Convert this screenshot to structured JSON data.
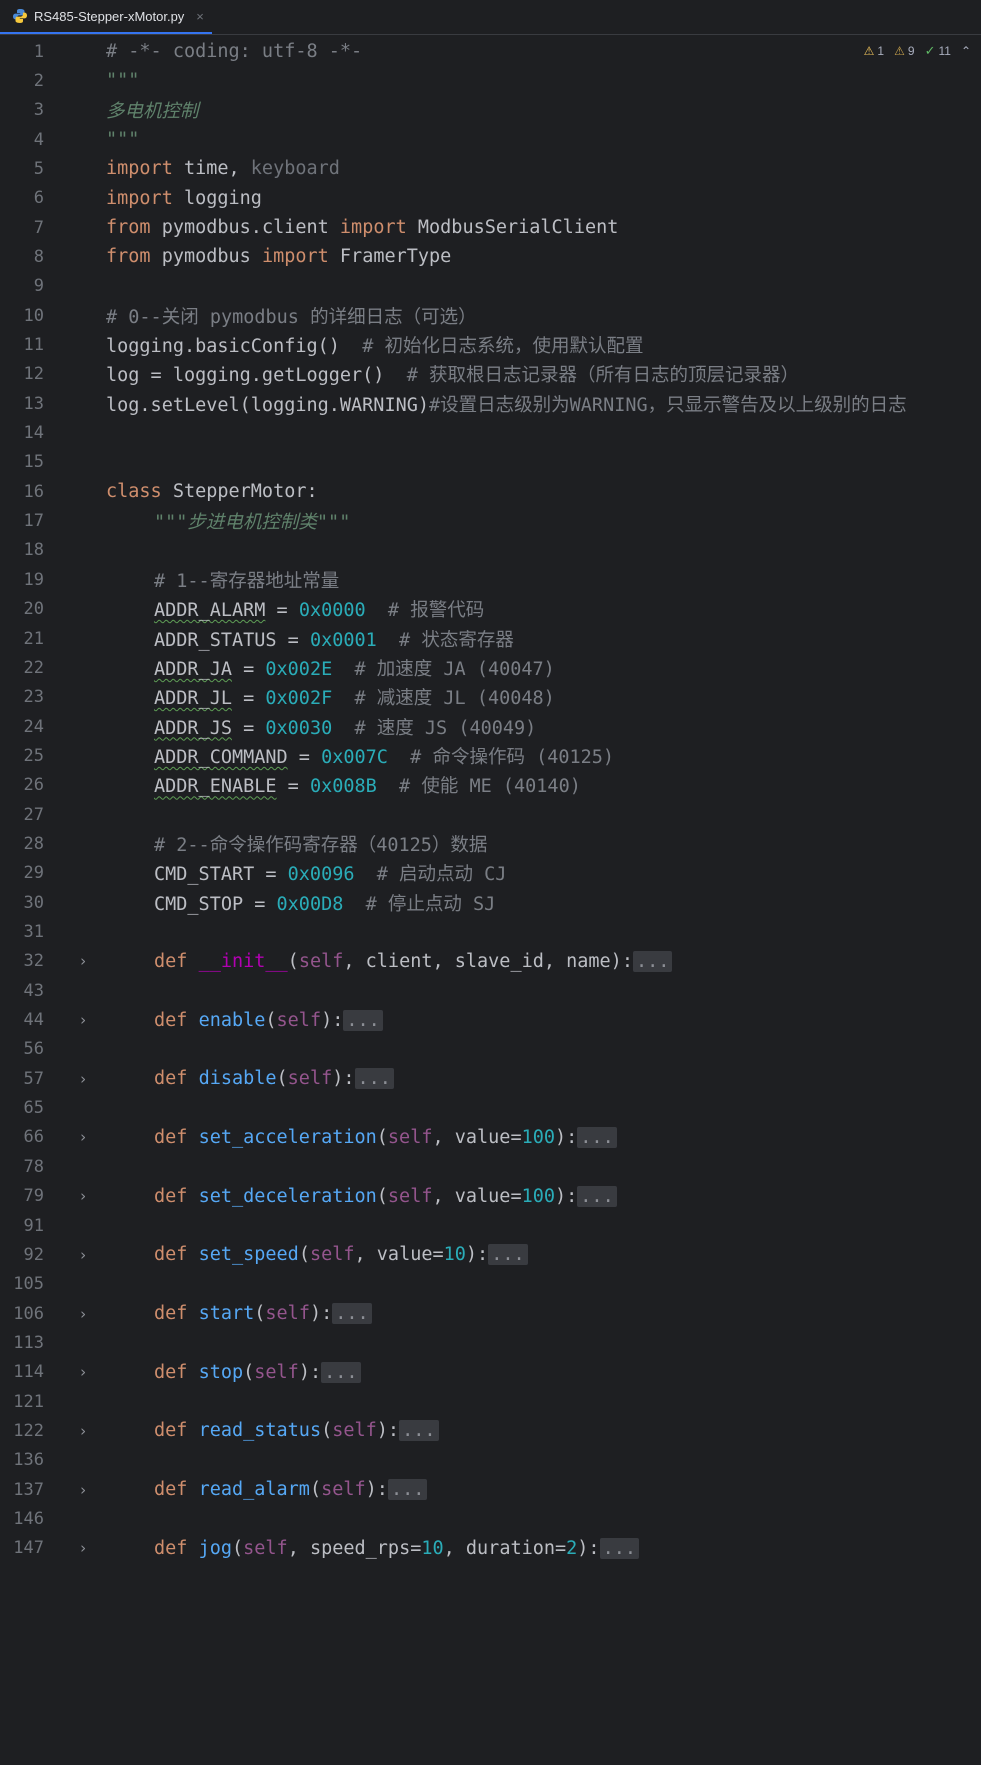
{
  "tab": {
    "filename": "RS485-Stepper-xMotor.py",
    "close": "×"
  },
  "indicators": {
    "warnings": "1",
    "weak_warnings": "9",
    "ok": "11"
  },
  "lines": [
    {
      "n": "1",
      "fold": false,
      "segs": [
        [
          "c-com",
          "# -*- coding: utf-8 -*-"
        ]
      ]
    },
    {
      "n": "2",
      "fold": false,
      "segs": [
        [
          "c-doc",
          "\"\"\""
        ]
      ]
    },
    {
      "n": "3",
      "fold": false,
      "segs": [
        [
          "c-doc",
          "多电机控制"
        ]
      ]
    },
    {
      "n": "4",
      "fold": false,
      "segs": [
        [
          "c-doc",
          "\"\"\""
        ]
      ]
    },
    {
      "n": "5",
      "fold": false,
      "segs": [
        [
          "c-kw",
          "import "
        ],
        [
          "c-plain",
          "time, "
        ],
        [
          "c-unused",
          "keyboard"
        ]
      ]
    },
    {
      "n": "6",
      "fold": false,
      "segs": [
        [
          "c-kw",
          "import "
        ],
        [
          "c-plain",
          "logging"
        ]
      ]
    },
    {
      "n": "7",
      "fold": false,
      "segs": [
        [
          "c-kw",
          "from "
        ],
        [
          "c-plain",
          "pymodbus.client "
        ],
        [
          "c-kw",
          "import "
        ],
        [
          "c-plain",
          "ModbusSerialClient"
        ]
      ]
    },
    {
      "n": "8",
      "fold": false,
      "segs": [
        [
          "c-kw",
          "from "
        ],
        [
          "c-plain",
          "pymodbus "
        ],
        [
          "c-kw",
          "import "
        ],
        [
          "c-plain",
          "FramerType"
        ]
      ]
    },
    {
      "n": "9",
      "fold": false,
      "segs": []
    },
    {
      "n": "10",
      "fold": false,
      "segs": [
        [
          "c-com",
          "# 0--关闭 pymodbus 的详细日志（可选）"
        ]
      ]
    },
    {
      "n": "11",
      "fold": false,
      "segs": [
        [
          "c-plain",
          "logging.basicConfig()  "
        ],
        [
          "c-com",
          "# 初始化日志系统，使用默认配置"
        ]
      ]
    },
    {
      "n": "12",
      "fold": false,
      "segs": [
        [
          "c-plain",
          "log = logging.getLogger()  "
        ],
        [
          "c-com",
          "# 获取根日志记录器（所有日志的顶层记录器）"
        ]
      ]
    },
    {
      "n": "13",
      "fold": false,
      "segs": [
        [
          "c-plain",
          "log.setLevel(logging.WARNING)"
        ],
        [
          "c-com",
          "#设置日志级别为WARNING，只显示警告及以上级别的日志"
        ]
      ]
    },
    {
      "n": "14",
      "fold": false,
      "segs": []
    },
    {
      "n": "15",
      "fold": false,
      "segs": []
    },
    {
      "n": "16",
      "fold": false,
      "segs": [
        [
          "c-kw",
          "class "
        ],
        [
          "c-plain",
          "StepperMotor:"
        ]
      ]
    },
    {
      "n": "17",
      "fold": false,
      "indent": true,
      "segs": [
        [
          "c-doc",
          "\"\"\"步进电机控制类\"\"\""
        ]
      ]
    },
    {
      "n": "18",
      "fold": false,
      "segs": []
    },
    {
      "n": "19",
      "fold": false,
      "indent": true,
      "segs": [
        [
          "c-com",
          "# 1--寄存器地址常量"
        ]
      ]
    },
    {
      "n": "20",
      "fold": false,
      "indent": true,
      "segs": [
        [
          "c-plain c-warnu",
          "ADDR_ALARM"
        ],
        [
          "c-plain",
          " = "
        ],
        [
          "c-num",
          "0x0000"
        ],
        [
          "c-com",
          "  # 报警代码"
        ]
      ]
    },
    {
      "n": "21",
      "fold": false,
      "indent": true,
      "segs": [
        [
          "c-plain",
          "ADDR_STATUS = "
        ],
        [
          "c-num",
          "0x0001"
        ],
        [
          "c-com",
          "  # 状态寄存器"
        ]
      ]
    },
    {
      "n": "22",
      "fold": false,
      "indent": true,
      "segs": [
        [
          "c-plain c-warnu",
          "ADDR_JA"
        ],
        [
          "c-plain",
          " = "
        ],
        [
          "c-num",
          "0x002E"
        ],
        [
          "c-com",
          "  # 加速度 JA (40047)"
        ]
      ]
    },
    {
      "n": "23",
      "fold": false,
      "indent": true,
      "segs": [
        [
          "c-plain c-warnu",
          "ADDR_JL"
        ],
        [
          "c-plain",
          " = "
        ],
        [
          "c-num",
          "0x002F"
        ],
        [
          "c-com",
          "  # 减速度 JL (40048)"
        ]
      ]
    },
    {
      "n": "24",
      "fold": false,
      "indent": true,
      "segs": [
        [
          "c-plain c-warnu",
          "ADDR_JS"
        ],
        [
          "c-plain",
          " = "
        ],
        [
          "c-num",
          "0x0030"
        ],
        [
          "c-com",
          "  # 速度 JS (40049)"
        ]
      ]
    },
    {
      "n": "25",
      "fold": false,
      "indent": true,
      "segs": [
        [
          "c-plain c-warnu",
          "ADDR_COMMAND"
        ],
        [
          "c-plain",
          " = "
        ],
        [
          "c-num",
          "0x007C"
        ],
        [
          "c-com",
          "  # 命令操作码 (40125)"
        ]
      ]
    },
    {
      "n": "26",
      "fold": false,
      "indent": true,
      "segs": [
        [
          "c-plain c-warnu",
          "ADDR_ENABLE"
        ],
        [
          "c-plain",
          " = "
        ],
        [
          "c-num",
          "0x008B"
        ],
        [
          "c-com",
          "  # 使能 ME (40140)"
        ]
      ]
    },
    {
      "n": "27",
      "fold": false,
      "segs": []
    },
    {
      "n": "28",
      "fold": false,
      "indent": true,
      "segs": [
        [
          "c-com",
          "# 2--命令操作码寄存器（40125）数据"
        ]
      ]
    },
    {
      "n": "29",
      "fold": false,
      "indent": true,
      "segs": [
        [
          "c-plain",
          "CMD_START = "
        ],
        [
          "c-num",
          "0x0096"
        ],
        [
          "c-com",
          "  # 启动点动 CJ"
        ]
      ]
    },
    {
      "n": "30",
      "fold": false,
      "indent": true,
      "segs": [
        [
          "c-plain",
          "CMD_STOP = "
        ],
        [
          "c-num",
          "0x00D8"
        ],
        [
          "c-com",
          "  # 停止点动 SJ"
        ]
      ]
    },
    {
      "n": "31",
      "fold": false,
      "segs": []
    },
    {
      "n": "32",
      "fold": true,
      "indent": true,
      "segs": [
        [
          "c-kw",
          "def "
        ],
        [
          "c-magic",
          "__init__"
        ],
        [
          "c-plain",
          "("
        ],
        [
          "c-self",
          "self"
        ],
        [
          "c-plain",
          ", client, slave_id, name):"
        ],
        [
          "folded",
          "..."
        ]
      ]
    },
    {
      "n": "43",
      "fold": false,
      "segs": []
    },
    {
      "n": "44",
      "fold": true,
      "indent": true,
      "segs": [
        [
          "c-kw",
          "def "
        ],
        [
          "c-fn",
          "enable"
        ],
        [
          "c-plain",
          "("
        ],
        [
          "c-self",
          "self"
        ],
        [
          "c-plain",
          "):"
        ],
        [
          "folded",
          "..."
        ]
      ]
    },
    {
      "n": "56",
      "fold": false,
      "segs": []
    },
    {
      "n": "57",
      "fold": true,
      "indent": true,
      "segs": [
        [
          "c-kw",
          "def "
        ],
        [
          "c-fn",
          "disable"
        ],
        [
          "c-plain",
          "("
        ],
        [
          "c-self",
          "self"
        ],
        [
          "c-plain",
          "):"
        ],
        [
          "folded",
          "..."
        ]
      ]
    },
    {
      "n": "65",
      "fold": false,
      "segs": []
    },
    {
      "n": "66",
      "fold": true,
      "indent": true,
      "segs": [
        [
          "c-kw",
          "def "
        ],
        [
          "c-fn",
          "set_acceleration"
        ],
        [
          "c-plain",
          "("
        ],
        [
          "c-self",
          "self"
        ],
        [
          "c-plain",
          ", value="
        ],
        [
          "c-num",
          "100"
        ],
        [
          "c-plain",
          "):"
        ],
        [
          "folded",
          "..."
        ]
      ]
    },
    {
      "n": "78",
      "fold": false,
      "segs": []
    },
    {
      "n": "79",
      "fold": true,
      "indent": true,
      "segs": [
        [
          "c-kw",
          "def "
        ],
        [
          "c-fn",
          "set_deceleration"
        ],
        [
          "c-plain",
          "("
        ],
        [
          "c-self",
          "self"
        ],
        [
          "c-plain",
          ", value="
        ],
        [
          "c-num",
          "100"
        ],
        [
          "c-plain",
          "):"
        ],
        [
          "folded",
          "..."
        ]
      ]
    },
    {
      "n": "91",
      "fold": false,
      "segs": []
    },
    {
      "n": "92",
      "fold": true,
      "indent": true,
      "segs": [
        [
          "c-kw",
          "def "
        ],
        [
          "c-fn",
          "set_speed"
        ],
        [
          "c-plain",
          "("
        ],
        [
          "c-self",
          "self"
        ],
        [
          "c-plain",
          ", value="
        ],
        [
          "c-num",
          "10"
        ],
        [
          "c-plain",
          "):"
        ],
        [
          "folded",
          "..."
        ]
      ]
    },
    {
      "n": "105",
      "fold": false,
      "segs": []
    },
    {
      "n": "106",
      "fold": true,
      "indent": true,
      "segs": [
        [
          "c-kw",
          "def "
        ],
        [
          "c-fn",
          "start"
        ],
        [
          "c-plain",
          "("
        ],
        [
          "c-self",
          "self"
        ],
        [
          "c-plain",
          "):"
        ],
        [
          "folded",
          "..."
        ]
      ]
    },
    {
      "n": "113",
      "fold": false,
      "segs": []
    },
    {
      "n": "114",
      "fold": true,
      "indent": true,
      "segs": [
        [
          "c-kw",
          "def "
        ],
        [
          "c-fn",
          "stop"
        ],
        [
          "c-plain",
          "("
        ],
        [
          "c-self",
          "self"
        ],
        [
          "c-plain",
          "):"
        ],
        [
          "folded",
          "..."
        ]
      ]
    },
    {
      "n": "121",
      "fold": false,
      "segs": []
    },
    {
      "n": "122",
      "fold": true,
      "indent": true,
      "segs": [
        [
          "c-kw",
          "def "
        ],
        [
          "c-fn",
          "read_status"
        ],
        [
          "c-plain",
          "("
        ],
        [
          "c-self",
          "self"
        ],
        [
          "c-plain",
          "):"
        ],
        [
          "folded",
          "..."
        ]
      ]
    },
    {
      "n": "136",
      "fold": false,
      "segs": []
    },
    {
      "n": "137",
      "fold": true,
      "indent": true,
      "segs": [
        [
          "c-kw",
          "def "
        ],
        [
          "c-fn",
          "read_alarm"
        ],
        [
          "c-plain",
          "("
        ],
        [
          "c-self",
          "self"
        ],
        [
          "c-plain",
          "):"
        ],
        [
          "folded",
          "..."
        ]
      ]
    },
    {
      "n": "146",
      "fold": false,
      "segs": []
    },
    {
      "n": "147",
      "fold": true,
      "indent": true,
      "segs": [
        [
          "c-kw",
          "def "
        ],
        [
          "c-fn",
          "jog"
        ],
        [
          "c-plain",
          "("
        ],
        [
          "c-self",
          "self"
        ],
        [
          "c-plain",
          ", speed_rps="
        ],
        [
          "c-num",
          "10"
        ],
        [
          "c-plain",
          ", duration="
        ],
        [
          "c-num",
          "2"
        ],
        [
          "c-plain",
          "):"
        ],
        [
          "folded",
          "..."
        ]
      ]
    }
  ]
}
